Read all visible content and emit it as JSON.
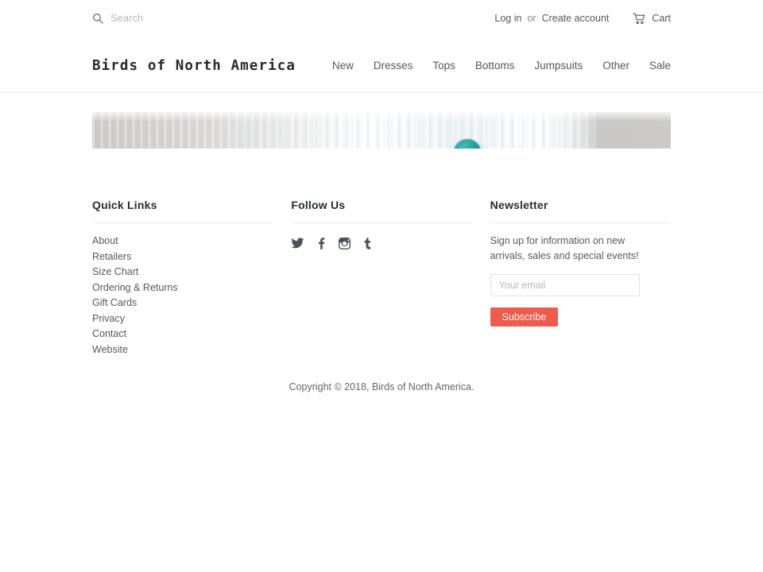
{
  "topbar": {
    "search_placeholder": "Search",
    "search_value": "",
    "search_icon": "search-icon",
    "login_label": "Log in",
    "or_label": "or",
    "create_account_label": "Create account",
    "cart_icon": "shopping-cart-icon",
    "cart_label": "Cart"
  },
  "header": {
    "logo": "Birds of North America",
    "nav": [
      {
        "label": "New"
      },
      {
        "label": "Dresses"
      },
      {
        "label": "Tops"
      },
      {
        "label": "Bottoms"
      },
      {
        "label": "Jumpsuits"
      },
      {
        "label": "Other"
      },
      {
        "label": "Sale"
      }
    ]
  },
  "banner": {
    "name": "hero-banner-image",
    "accent_color": "#1e9c9b"
  },
  "footer": {
    "quick_links": {
      "heading": "Quick Links",
      "items": [
        {
          "label": "About"
        },
        {
          "label": "Retailers"
        },
        {
          "label": "Size Chart"
        },
        {
          "label": "Ordering & Returns"
        },
        {
          "label": "Gift Cards"
        },
        {
          "label": "Privacy"
        },
        {
          "label": "Contact"
        },
        {
          "label": "Website"
        }
      ]
    },
    "follow_us": {
      "heading": "Follow Us",
      "socials": [
        {
          "name": "twitter-icon",
          "label": "Twitter"
        },
        {
          "name": "facebook-icon",
          "label": "Facebook"
        },
        {
          "name": "instagram-icon",
          "label": "Instagram"
        },
        {
          "name": "tumblr-icon",
          "label": "Tumblr"
        }
      ]
    },
    "newsletter": {
      "heading": "Newsletter",
      "description": "Sign up for information on new arrivals, sales and special events!",
      "email_placeholder": "Your email",
      "email_value": "",
      "subscribe_label": "Subscribe",
      "subscribe_color": "#ef5b4c"
    },
    "copyright": "Copyright © 2018, Birds of North America."
  }
}
